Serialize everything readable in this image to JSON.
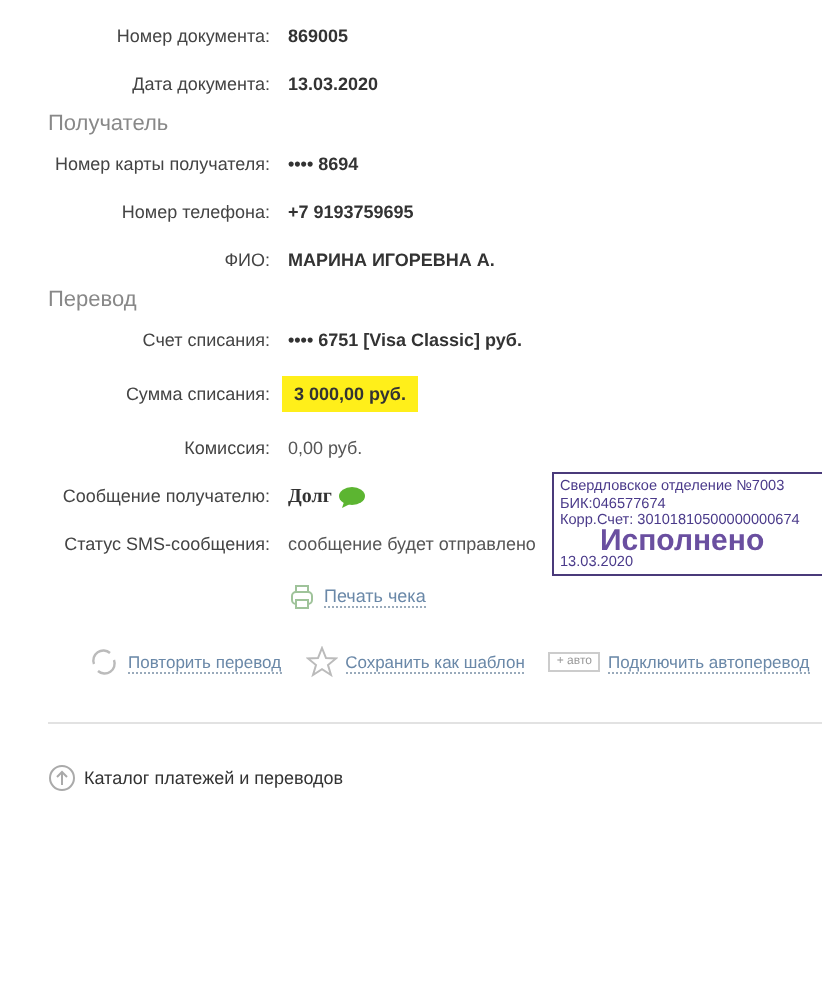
{
  "document_rows": [
    {
      "label": "Номер документа:",
      "value": "869005",
      "kind": "bold"
    },
    {
      "label": "Дата документа:",
      "value": "13.03.2020",
      "kind": "bold"
    }
  ],
  "sections": [
    {
      "title": "Получатель",
      "rows": [
        {
          "label": "Номер карты получателя:",
          "value": "•••• 8694",
          "kind": "bold"
        },
        {
          "label": "Номер телефона:",
          "value": "+7 9193759695",
          "kind": "bold"
        },
        {
          "label": "ФИО:",
          "value": "МАРИНА ИГОРЕВНА А.",
          "kind": "bold"
        }
      ]
    },
    {
      "title": "Перевод",
      "rows": [
        {
          "label": "Счет списания:",
          "value": "•••• 6751  [Visa Classic]  руб.",
          "kind": "bold"
        },
        {
          "label": "Сумма списания:",
          "value": "3 000,00  руб.",
          "kind": "highlight"
        },
        {
          "label": "Комиссия:",
          "value": "0,00 руб.",
          "kind": "plain"
        },
        {
          "label": "Сообщение получателю:",
          "value": "Долг",
          "kind": "message"
        },
        {
          "label": "Статус SMS-сообщения:",
          "value": "сообщение будет отправлено",
          "kind": "plain"
        }
      ]
    }
  ],
  "stamp": {
    "lines": [
      "Свердловское отделение №7003",
      "БИК:046577674",
      "Корр.Счет: 30101810500000000674"
    ],
    "status": "Исполнено",
    "date": "13.03.2020"
  },
  "print_link": "Печать чека",
  "actions": [
    {
      "kind": "repeat",
      "label": "Повторить перевод"
    },
    {
      "kind": "template",
      "label": "Сохранить как шаблон"
    },
    {
      "kind": "auto",
      "label": "Подключить автоперевод",
      "icon_text": "+ авто"
    }
  ],
  "catalog_link": "Каталог платежей и переводов"
}
